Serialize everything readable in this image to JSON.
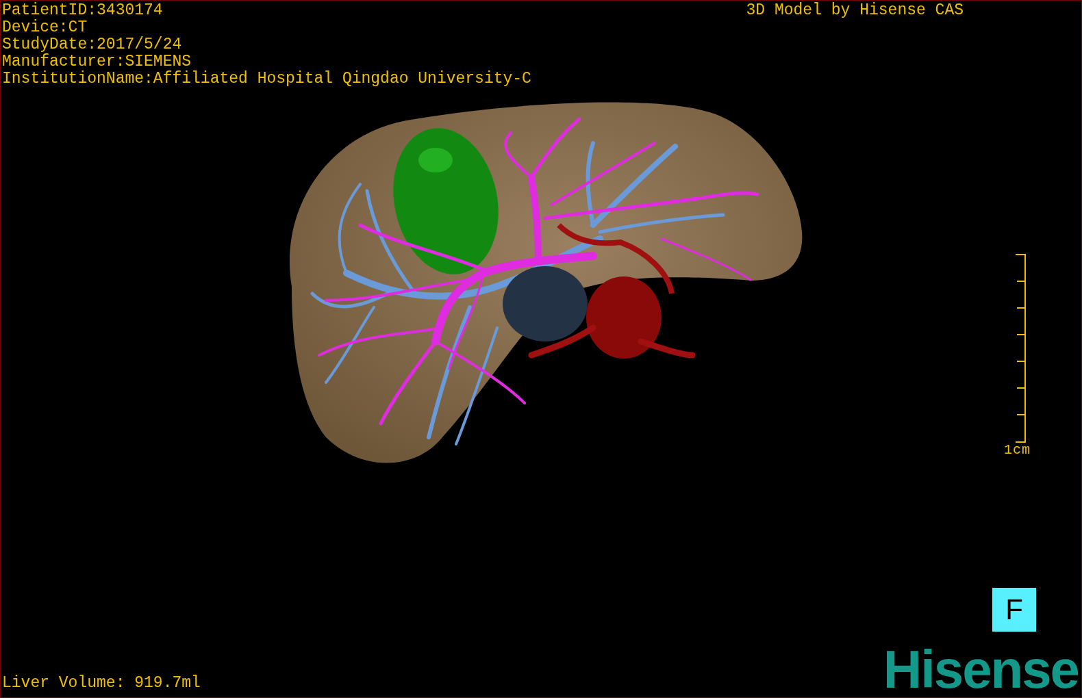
{
  "header": {
    "info_lines": [
      "PatientID:3430174",
      "Device:CT",
      "StudyDate:2017/5/24",
      "Manufacturer:SIEMENS",
      "InstitutionName:Affiliated Hospital Qingdao University-C"
    ],
    "credit": "3D Model by Hisense CAS"
  },
  "scale_bar": {
    "label": "1cm"
  },
  "orientation_marker": {
    "label": "F"
  },
  "measurement": "Liver Volume: 919.7ml",
  "logo": "Hisense"
}
